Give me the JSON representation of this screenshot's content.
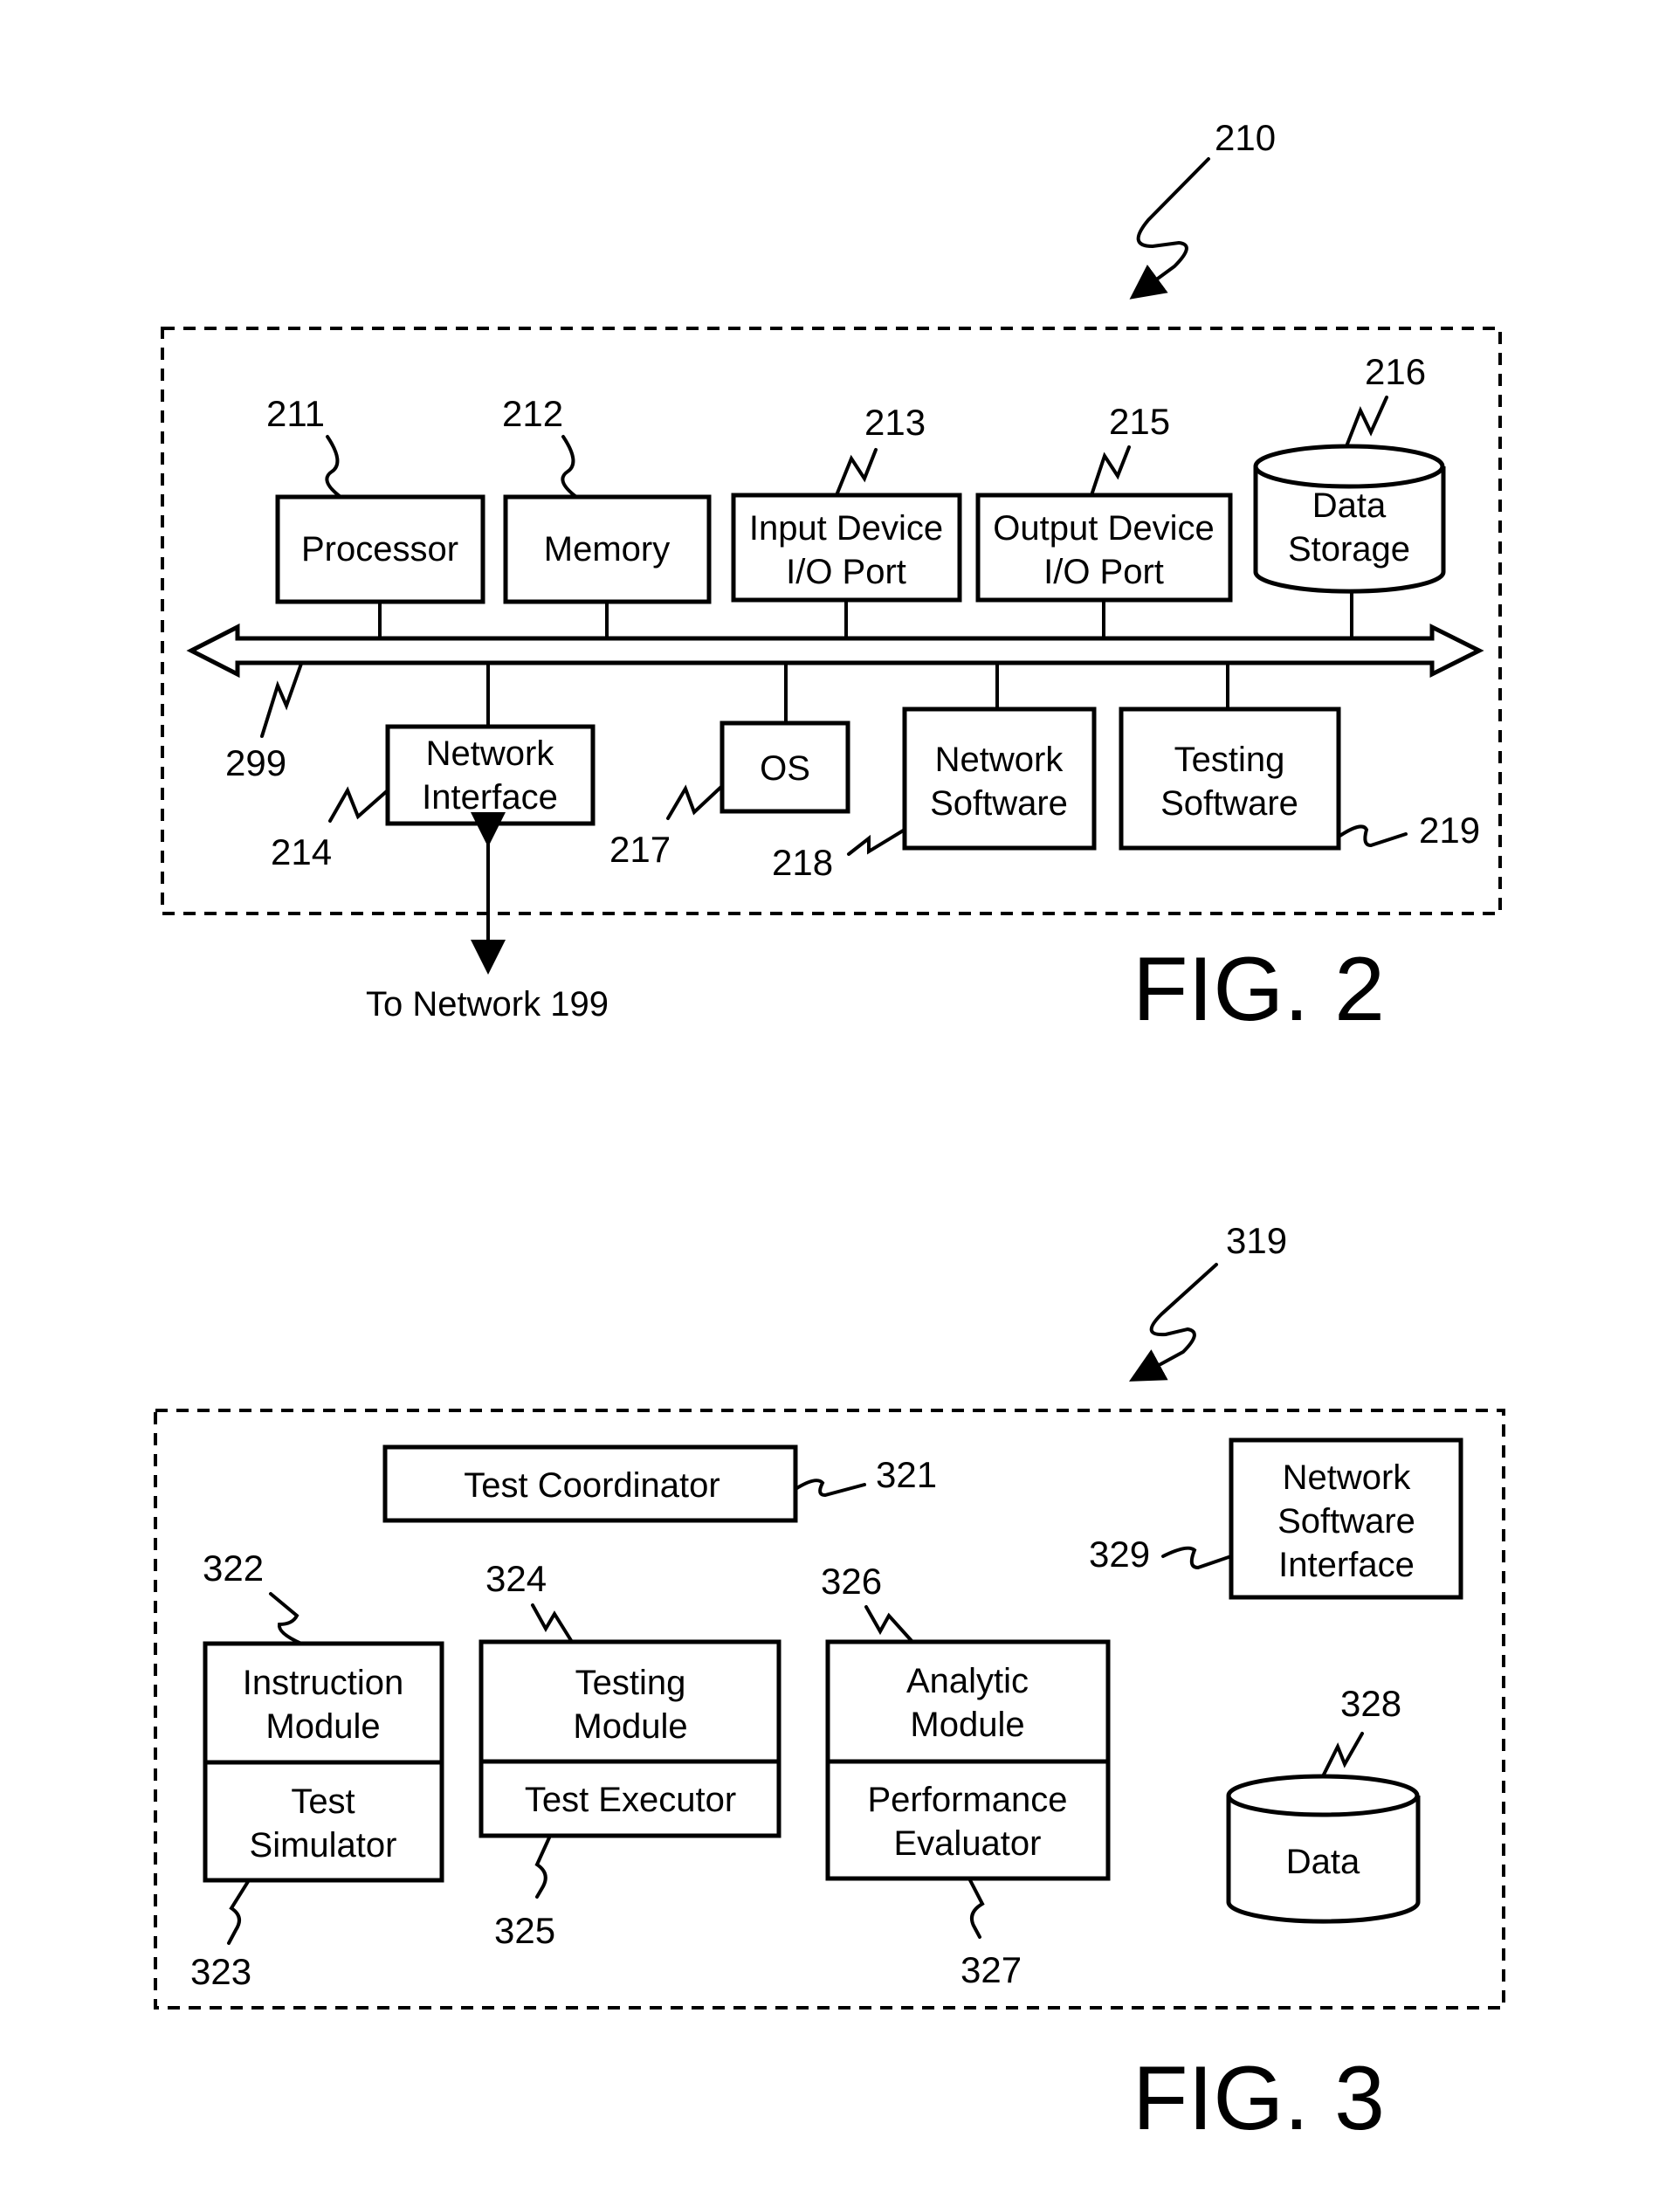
{
  "fig2": {
    "caption": "FIG. 2",
    "ref": "210",
    "bus_ref": "299",
    "network_link_label": "To Network 199",
    "components": {
      "processor": {
        "ref": "211",
        "lines": [
          "Processor"
        ]
      },
      "memory": {
        "ref": "212",
        "lines": [
          "Memory"
        ]
      },
      "input_port": {
        "ref": "213",
        "lines": [
          "Input Device",
          "I/O Port"
        ]
      },
      "network_interface": {
        "ref": "214",
        "lines": [
          "Network",
          "Interface"
        ]
      },
      "output_port": {
        "ref": "215",
        "lines": [
          "Output Device",
          "I/O Port"
        ]
      },
      "data_storage": {
        "ref": "216",
        "lines": [
          "Data",
          "Storage"
        ]
      },
      "os": {
        "ref": "217",
        "lines": [
          "OS"
        ]
      },
      "network_software": {
        "ref": "218",
        "lines": [
          "Network",
          "Software"
        ]
      },
      "testing_software": {
        "ref": "219",
        "lines": [
          "Testing",
          "Software"
        ]
      }
    }
  },
  "fig3": {
    "caption": "FIG. 3",
    "ref": "319",
    "components": {
      "test_coordinator": {
        "ref": "321",
        "lines": [
          "Test Coordinator"
        ]
      },
      "instruction_module": {
        "ref": "322",
        "lines": [
          "Instruction",
          "Module"
        ]
      },
      "test_simulator": {
        "ref": "323",
        "lines": [
          "Test",
          "Simulator"
        ]
      },
      "testing_module": {
        "ref": "324",
        "lines": [
          "Testing",
          "Module"
        ]
      },
      "test_executor": {
        "ref": "325",
        "lines": [
          "Test Executor"
        ]
      },
      "analytic_module": {
        "ref": "326",
        "lines": [
          "Analytic",
          "Module"
        ]
      },
      "performance_evaluator": {
        "ref": "327",
        "lines": [
          "Performance",
          "Evaluator"
        ]
      },
      "data": {
        "ref": "328",
        "lines": [
          "Data"
        ]
      },
      "network_software_interface": {
        "ref": "329",
        "lines": [
          "Network",
          "Software",
          "Interface"
        ]
      }
    }
  }
}
